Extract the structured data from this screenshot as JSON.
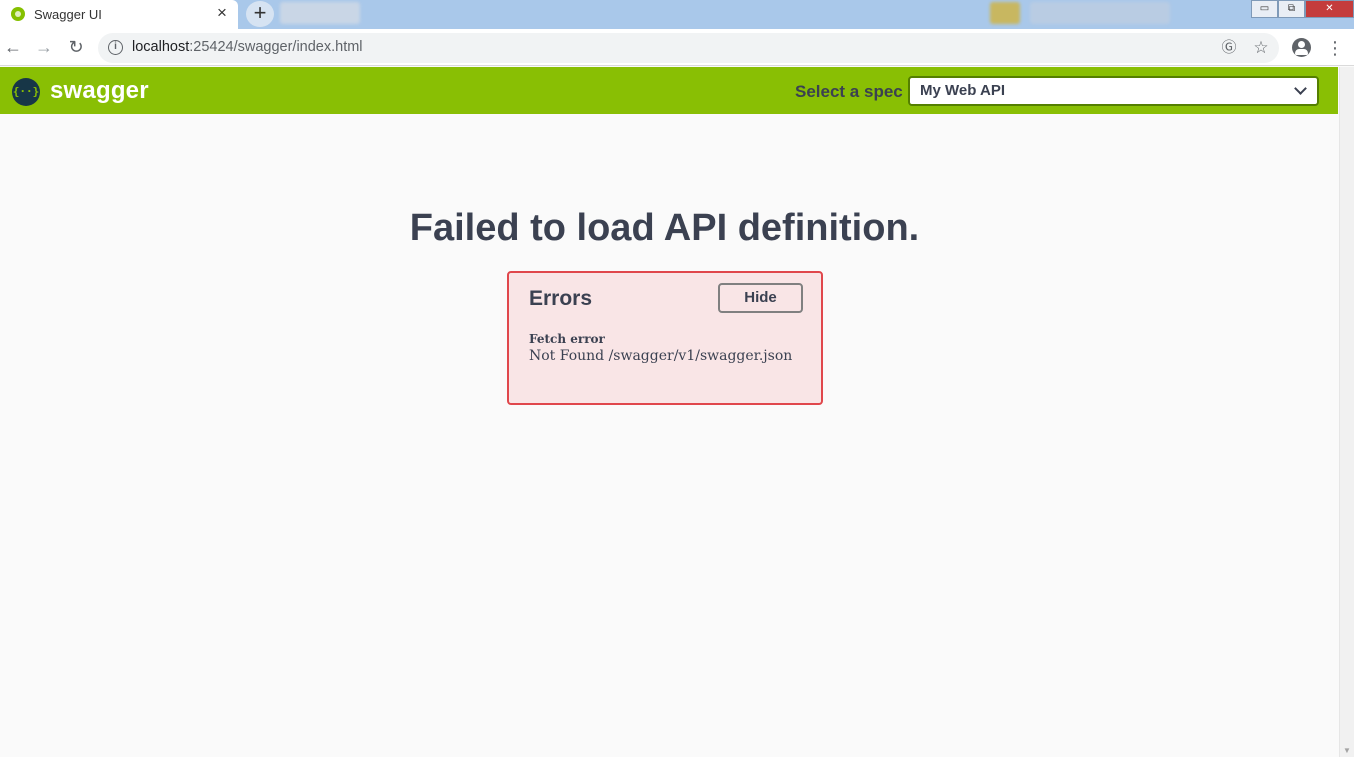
{
  "browser": {
    "tab": {
      "title": "Swagger UI",
      "close_glyph": "×"
    },
    "new_tab_glyph": "+",
    "window_controls": {
      "minimize": "▭",
      "restore": "⧉",
      "close": "✕"
    },
    "nav": {
      "back": "←",
      "forward": "→",
      "reload": "↻"
    },
    "address": {
      "host": "localhost",
      "path": ":25424/swagger/index.html",
      "info_glyph": "i"
    },
    "icons": {
      "translate": "Ⓖ",
      "bookmark": "☆",
      "menu": "⋮"
    }
  },
  "topbar": {
    "logo_glyph": "{··}",
    "brand": "swagger",
    "spec_label": "Select a spec",
    "spec_selected": "My Web API",
    "background_color": "#89bf04"
  },
  "main": {
    "title": "Failed to load API definition."
  },
  "errors": {
    "title": "Errors",
    "hide_label": "Hide",
    "items": [
      {
        "heading": "Fetch error",
        "message": "Not Found /swagger/v1/swagger.json"
      }
    ],
    "border_color": "#e0474c",
    "background_color": "#f9e5e6"
  }
}
